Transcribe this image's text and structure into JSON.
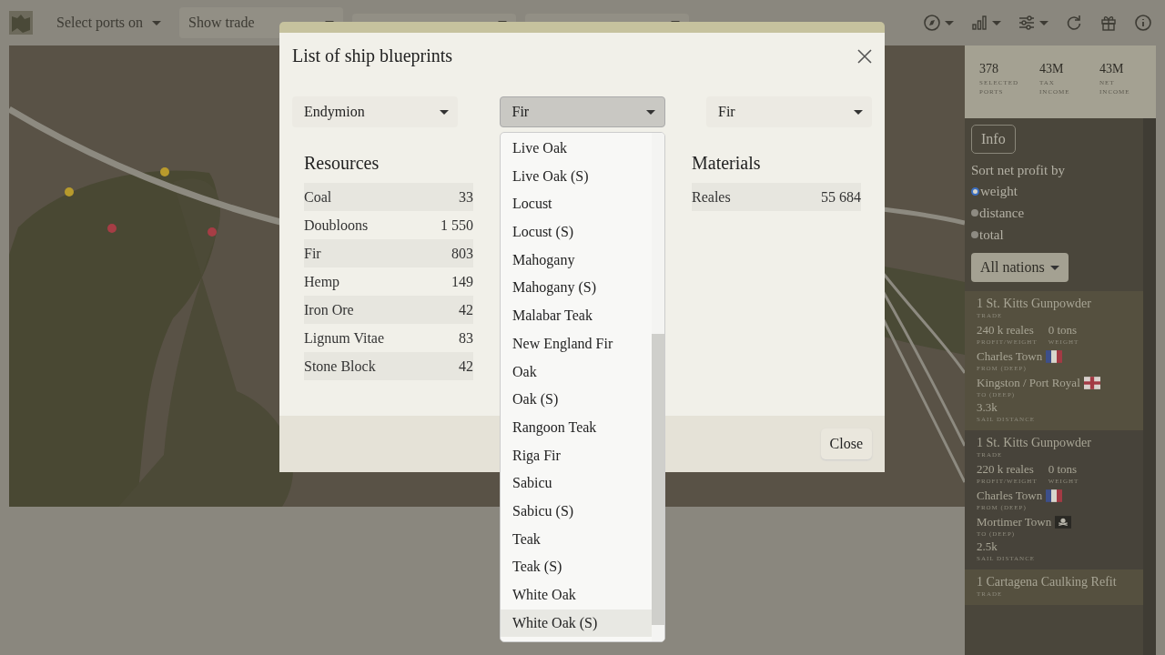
{
  "toolbar": {
    "menus": [
      {
        "label": "Select ports on",
        "kind": "plain"
      },
      {
        "label": "Show trade",
        "kind": "boxed"
      },
      {
        "kind": "boxed"
      },
      {
        "kind": "boxed"
      }
    ],
    "icons": [
      {
        "kind": "compass",
        "caret": true
      },
      {
        "kind": "chart",
        "caret": true
      },
      {
        "kind": "sliders",
        "caret": true
      },
      {
        "kind": "refresh",
        "caret": false
      },
      {
        "kind": "gift",
        "caret": false
      },
      {
        "kind": "info",
        "caret": false
      }
    ]
  },
  "sidebar": {
    "stats": [
      {
        "value": "378",
        "label": "SELECTED PORTS"
      },
      {
        "value": "43M",
        "label": "TAX INCOME"
      },
      {
        "value": "43M",
        "label": "NET INCOME"
      }
    ],
    "info_button": "Info",
    "sort_label": "Sort net profit by",
    "sort_options": [
      {
        "label": "weight",
        "selected": true
      },
      {
        "label": "distance",
        "selected": false
      },
      {
        "label": "total",
        "selected": false
      }
    ],
    "nations_button": "All nations",
    "trades": [
      {
        "title": "1 St. Kitts Gunpowder",
        "type": "TRADE",
        "highlighted": false,
        "profit": "240 k reales",
        "profit_label": "PROFIT/WEIGHT",
        "weight": "0 tons",
        "weight_label": "WEIGHT",
        "from": {
          "name": "Charles Town",
          "kind": "france"
        },
        "from_label": "FROM (DEEP)",
        "to": {
          "name": "Kingston / Port Royal",
          "kind": "britain"
        },
        "to_label": "TO (DEEP)",
        "distance": "3.3k",
        "distance_label": "SAIL DISTANCE"
      },
      {
        "title": "1 St. Kitts Gunpowder",
        "type": "TRADE",
        "highlighted": true,
        "profit": "220 k reales",
        "profit_label": "PROFIT/WEIGHT",
        "weight": "0 tons",
        "weight_label": "WEIGHT",
        "from": {
          "name": "Charles Town",
          "kind": "france"
        },
        "from_label": "FROM (DEEP)",
        "to": {
          "name": "Mortimer Town",
          "kind": "pirate"
        },
        "to_label": "TO (DEEP)",
        "distance": "2.5k",
        "distance_label": "SAIL DISTANCE"
      },
      {
        "title": "1 Cartagena Caulking Refit",
        "type": "TRADE",
        "highlighted": false
      }
    ]
  },
  "modal": {
    "title": "List of ship blueprints",
    "selects": [
      {
        "value": "Endymion",
        "open": false
      },
      {
        "value": "Fir",
        "open": true
      },
      {
        "value": "Fir",
        "open": false
      }
    ],
    "resources": {
      "heading": "Resources",
      "rows": [
        {
          "name": "Coal",
          "amount": "33"
        },
        {
          "name": "Doubloons",
          "amount": "1 550"
        },
        {
          "name": "Fir",
          "amount": "803"
        },
        {
          "name": "Hemp",
          "amount": "149"
        },
        {
          "name": "Iron Ore",
          "amount": "42"
        },
        {
          "name": "Lignum Vitae",
          "amount": "83"
        },
        {
          "name": "Stone Block",
          "amount": "42"
        }
      ]
    },
    "materials": {
      "heading": "Materials",
      "rows": [
        {
          "name": "Reales",
          "amount": "55 684"
        }
      ]
    },
    "dropdown_options": [
      {
        "label": "Live Oak",
        "hovered": false
      },
      {
        "label": "Live Oak (S)",
        "hovered": false
      },
      {
        "label": "Locust",
        "hovered": false
      },
      {
        "label": "Locust (S)",
        "hovered": false
      },
      {
        "label": "Mahogany",
        "hovered": false
      },
      {
        "label": "Mahogany (S)",
        "hovered": false
      },
      {
        "label": "Malabar Teak",
        "hovered": false
      },
      {
        "label": "New England Fir",
        "hovered": false
      },
      {
        "label": "Oak",
        "hovered": false
      },
      {
        "label": "Oak (S)",
        "hovered": false
      },
      {
        "label": "Rangoon Teak",
        "hovered": false
      },
      {
        "label": "Riga Fir",
        "hovered": false
      },
      {
        "label": "Sabicu",
        "hovered": false
      },
      {
        "label": "Sabicu (S)",
        "hovered": false
      },
      {
        "label": "Teak",
        "hovered": false
      },
      {
        "label": "Teak (S)",
        "hovered": false
      },
      {
        "label": "White Oak",
        "hovered": false
      },
      {
        "label": "White Oak (S)",
        "hovered": true
      }
    ],
    "close_button": "Close"
  }
}
